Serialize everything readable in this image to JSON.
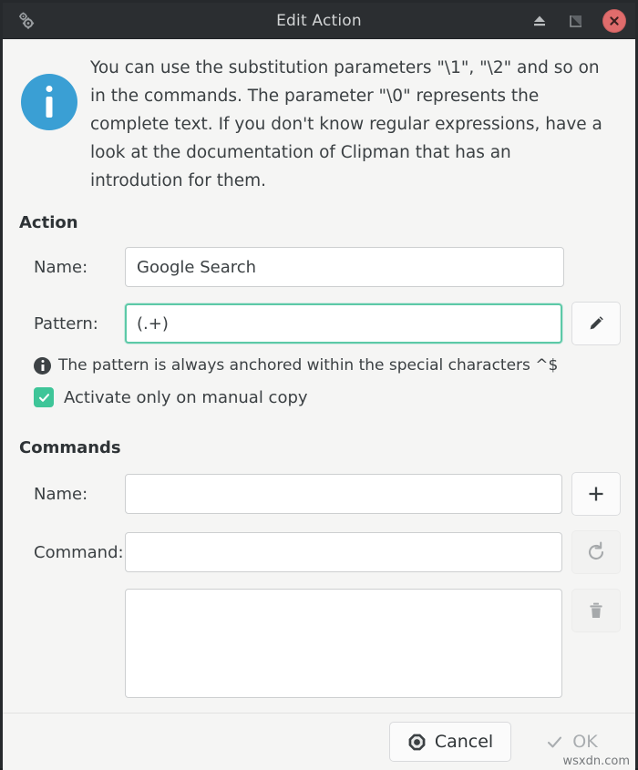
{
  "window": {
    "title": "Edit Action",
    "titlebar_buttons": {
      "menu_icon": "gears-icon",
      "shade_icon": "shade-icon",
      "maximize_icon": "maximize-icon",
      "close_icon": "close-icon"
    },
    "colors": {
      "titlebar_bg": "#2b2e31",
      "dialog_bg": "#f5f5f4",
      "close_button": "#e06c6c",
      "info_icon": "#3a9fd4",
      "focus_border": "#5cc9a7",
      "checkbox_checked": "#3ec598"
    }
  },
  "info": {
    "icon": "info-icon",
    "text": "You can use the substitution parameters \"\\1\", \"\\2\" and so on in the commands. The parameter \"\\0\" represents the complete text. If you don't know regular expressions, have a look at the documentation of Clipman that has an introdution for them."
  },
  "action_section": {
    "title": "Action",
    "name_label": "Name:",
    "name_value": "Google Search",
    "name_placeholder": "",
    "pattern_label": "Pattern:",
    "pattern_value": "(.+)",
    "pattern_placeholder": "",
    "pattern_focused": true,
    "edit_button_icon": "pencil-icon",
    "hint_text": "The pattern is always anchored within the special characters ^$",
    "checkbox_label": "Activate only on manual copy",
    "checkbox_checked": true
  },
  "commands_section": {
    "title": "Commands",
    "name_label": "Name:",
    "name_value": "",
    "name_placeholder": "",
    "add_button_icon": "plus-icon",
    "command_label": "Command:",
    "command_value": "",
    "command_placeholder": "",
    "refresh_button_icon": "refresh-icon",
    "delete_button_icon": "trash-icon",
    "list_items": []
  },
  "footer": {
    "cancel_label": "Cancel",
    "cancel_icon": "stop-icon",
    "ok_label": "OK",
    "ok_icon": "check-icon",
    "ok_enabled": false
  },
  "watermark": "wsxdn.com"
}
